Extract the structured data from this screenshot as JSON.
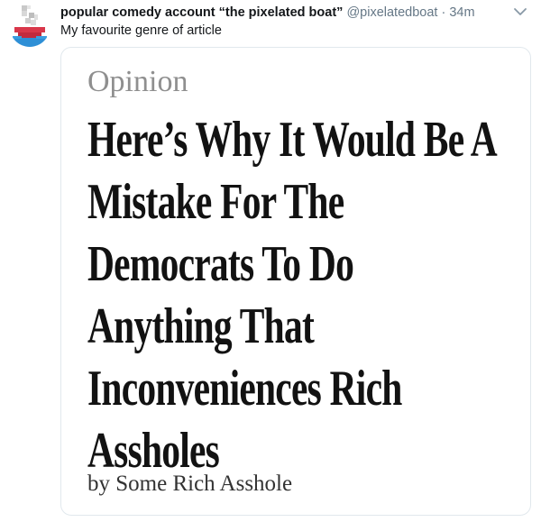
{
  "tweet": {
    "display_name": "popular comedy account “the pixelated boat”",
    "handle": "@pixelatedboat",
    "separator": "·",
    "time": "34m",
    "text": "My favourite genre of article",
    "avatar_icon": "pixelated-boat-icon",
    "menu_icon": "chevron-down-icon"
  },
  "card": {
    "kicker": "Opinion",
    "headline_lines": [
      "Here’s Why It Would Be A",
      "Mistake For The",
      "Democrats To Do",
      "Anything That",
      "Inconveniences Rich",
      "Assholes"
    ],
    "byline": "by Some Rich Asshole"
  },
  "colors": {
    "text_primary": "#14171a",
    "text_secondary": "#657786",
    "card_border": "#e1e8ed",
    "kicker": "#8f8f8f",
    "boat_hull": "#d9374a",
    "water": "#2e8fd6"
  }
}
